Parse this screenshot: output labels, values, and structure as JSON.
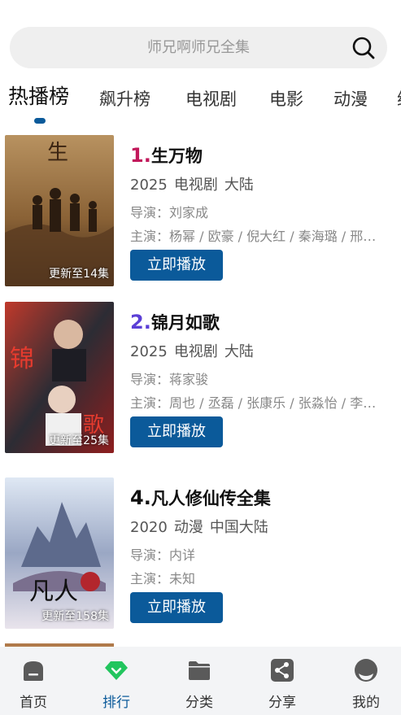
{
  "search": {
    "placeholder": "师兄啊师兄全集"
  },
  "tabs": [
    {
      "label": "热播榜",
      "active": true
    },
    {
      "label": "飙升榜"
    },
    {
      "label": "电视剧"
    },
    {
      "label": "电影"
    },
    {
      "label": "动漫"
    },
    {
      "label": "综"
    }
  ],
  "items": [
    {
      "rank": "1.",
      "rank_color": "#c2185b",
      "title": "生万物",
      "year": "2025",
      "type": "电视剧",
      "region": "大陆",
      "director": "导演：刘家成",
      "cast": "主演：杨幂 / 欧豪 / 倪大红 / 秦海璐 / 邢佳栋",
      "badge": "更新至14集",
      "button": "立即播放"
    },
    {
      "rank": "2.",
      "rank_color": "#5b3fd6",
      "title": "锦月如歌",
      "year": "2025",
      "type": "电视剧",
      "region": "大陆",
      "director": "导演：蒋家骏",
      "cast": "主演：周也 / 丞磊 / 张康乐 / 张淼怡 / 李若天",
      "badge": "更新至25集",
      "button": "立即播放"
    },
    {
      "rank": "4.",
      "rank_color": "#111111",
      "title": "凡人修仙传全集",
      "year": "2020",
      "type": "动漫",
      "region": "中国大陆",
      "director": "导演：内详",
      "cast": "主演：未知",
      "badge": "更新至158集",
      "button": "立即播放"
    }
  ],
  "nav": [
    {
      "label": "首页",
      "icon": "home-icon"
    },
    {
      "label": "排行",
      "icon": "ranking-icon",
      "active": true
    },
    {
      "label": "分类",
      "icon": "folder-icon"
    },
    {
      "label": "分享",
      "icon": "share-icon"
    },
    {
      "label": "我的",
      "icon": "profile-icon"
    }
  ],
  "colors": {
    "accent": "#0b5a9a",
    "ranking_icon": "#22c55e"
  }
}
